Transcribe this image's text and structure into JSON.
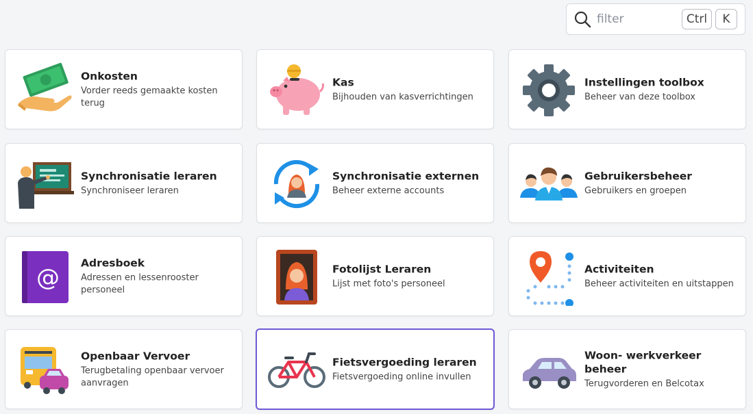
{
  "search": {
    "placeholder": "filter",
    "shortcut_ctrl": "Ctrl",
    "shortcut_key": "K"
  },
  "tiles": [
    {
      "title": "Onkosten",
      "desc": "Vorder reeds gemaakte kosten terug",
      "icon": "money-hand-icon"
    },
    {
      "title": "Kas",
      "desc": "Bijhouden van kasverrichtingen",
      "icon": "piggy-bank-icon"
    },
    {
      "title": "Instellingen toolbox",
      "desc": "Beheer van deze toolbox",
      "icon": "gear-icon"
    },
    {
      "title": "Synchronisatie leraren",
      "desc": "Synchroniseer leraren",
      "icon": "teacher-board-icon"
    },
    {
      "title": "Synchronisatie externen",
      "desc": "Beheer externe accounts",
      "icon": "sync-person-icon"
    },
    {
      "title": "Gebruikersbeheer",
      "desc": "Gebruikers en groepen",
      "icon": "users-group-icon"
    },
    {
      "title": "Adresboek",
      "desc": "Adressen en lessenrooster personeel",
      "icon": "address-book-icon"
    },
    {
      "title": "Fotolijst Leraren",
      "desc": "Lijst met foto's personeel",
      "icon": "photo-frame-icon"
    },
    {
      "title": "Activiteiten",
      "desc": "Beheer activiteiten en uitstappen",
      "icon": "route-pin-icon"
    },
    {
      "title": "Openbaar Vervoer",
      "desc": "Terugbetaling openbaar vervoer aanvragen",
      "icon": "bus-car-icon"
    },
    {
      "title": "Fietsvergoeding leraren",
      "desc": "Fietsvergoeding online invullen",
      "icon": "bicycle-icon"
    },
    {
      "title": "Woon- werkverkeer beheer",
      "desc": "Terugvorderen en Belcotax",
      "icon": "car-icon"
    }
  ],
  "colors": {
    "active_border": "#6f58d6",
    "page_bg": "#f4f5f7"
  }
}
